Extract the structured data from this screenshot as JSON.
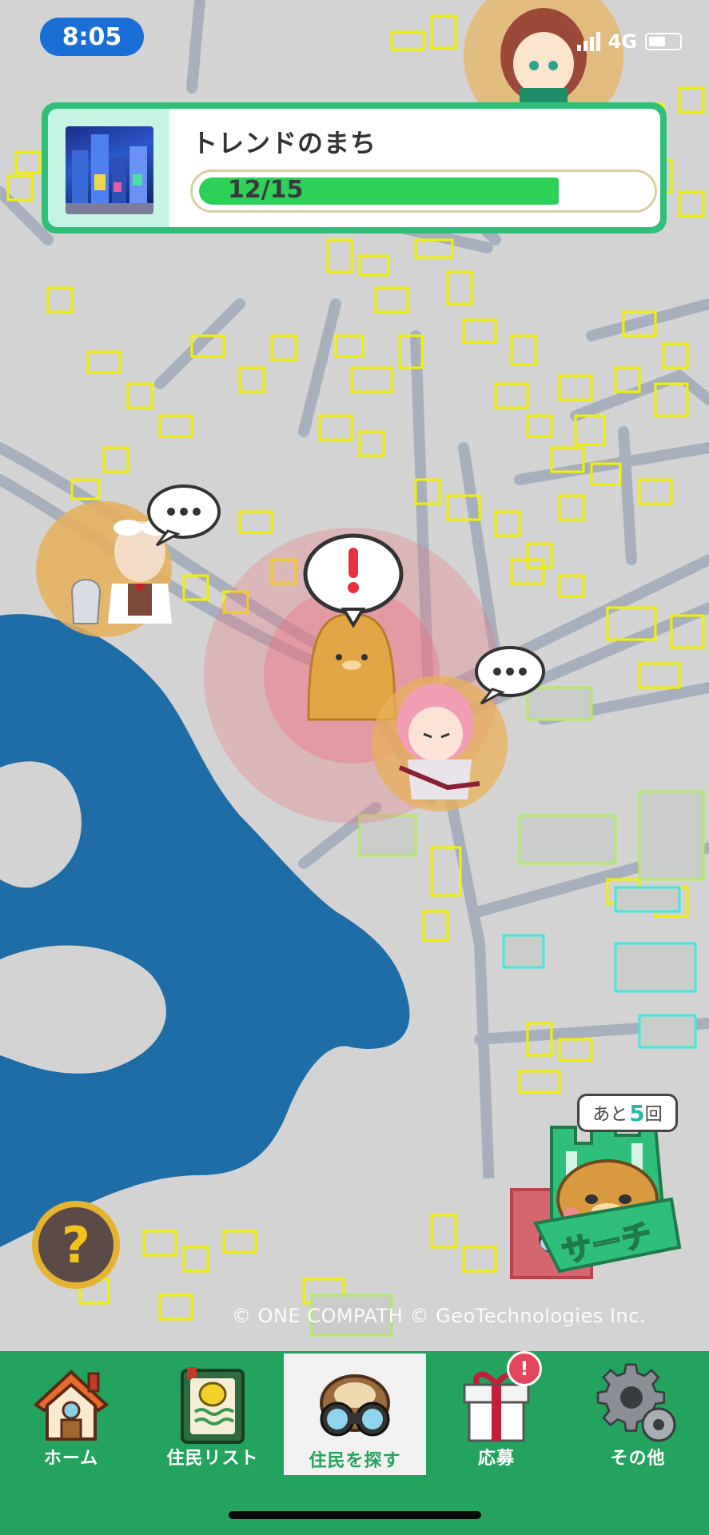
{
  "status_bar": {
    "time": "8:05",
    "network": "4G"
  },
  "town_card": {
    "title": "トレンドのまち",
    "progress_text": "12/15",
    "progress_fraction": 0.8
  },
  "map": {
    "remaining_badge": {
      "prefix": "あと",
      "count": "5",
      "suffix": "回"
    },
    "search_button_text": "サーチ",
    "help_symbol": "?",
    "copyright": "© ONE COMPATH © GeoTechnologies Inc."
  },
  "tabs": [
    {
      "label": "ホーム",
      "icon": "house-icon"
    },
    {
      "label": "住民リスト",
      "icon": "resident-book-icon"
    },
    {
      "label": "住民を探す",
      "icon": "otter-binoculars-icon",
      "active": true
    },
    {
      "label": "応募",
      "icon": "gift-box-icon",
      "alert": "!"
    },
    {
      "label": "その他",
      "icon": "gear-icon"
    }
  ],
  "colors": {
    "map_land": "#d2d3d2",
    "water": "#1e6da6",
    "building_outline": "#f2f200",
    "tab_bar": "#24a35f",
    "accent_green": "#2ed158",
    "status_pill": "#1a6fd6"
  }
}
